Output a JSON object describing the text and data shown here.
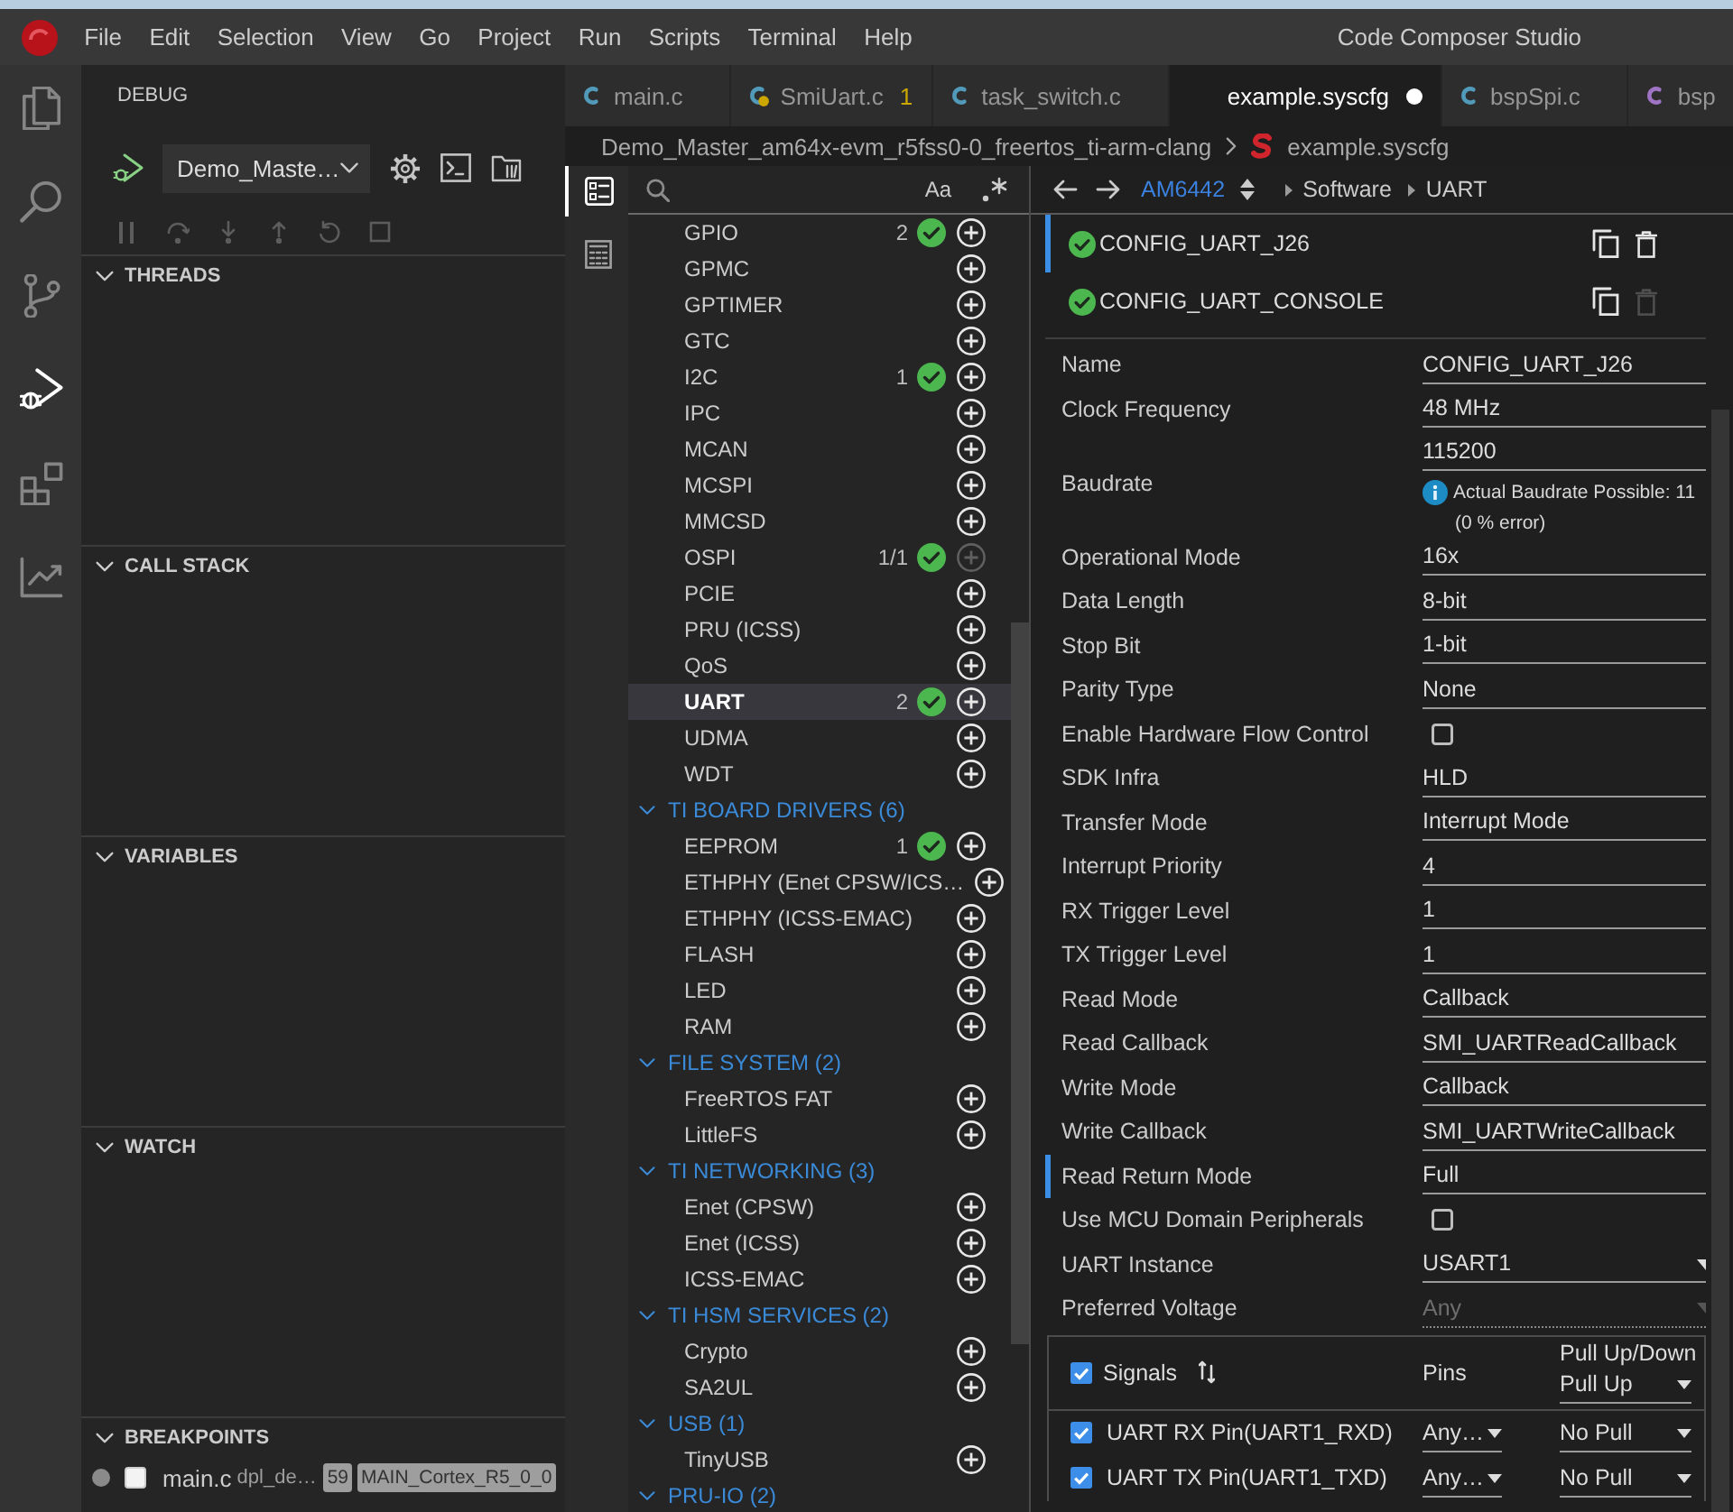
{
  "window": {
    "title": "Code Composer Studio"
  },
  "menu": [
    "File",
    "Edit",
    "Selection",
    "View",
    "Go",
    "Project",
    "Run",
    "Scripts",
    "Terminal",
    "Help"
  ],
  "activity_bar": [
    {
      "kind": "files",
      "selected": false
    },
    {
      "kind": "search",
      "selected": false
    },
    {
      "kind": "source_control",
      "selected": false
    },
    {
      "kind": "run_debug",
      "selected": true
    },
    {
      "kind": "extensions",
      "selected": false
    },
    {
      "kind": "chart",
      "selected": false
    }
  ],
  "sidebar": {
    "title": "DEBUG",
    "launch_config": "Demo_Maste…",
    "debug_controls": [
      {
        "kind": "pause",
        "disabled": true
      },
      {
        "kind": "step_over",
        "disabled": true
      },
      {
        "kind": "step_into",
        "disabled": true
      },
      {
        "kind": "step_out",
        "disabled": true
      },
      {
        "kind": "restart",
        "disabled": true
      },
      {
        "kind": "stop",
        "disabled": true
      }
    ],
    "sections": [
      {
        "title": "THREADS",
        "expanded": true
      },
      {
        "title": "CALL STACK",
        "expanded": true
      },
      {
        "title": "VARIABLES",
        "expanded": true
      },
      {
        "title": "WATCH",
        "expanded": true
      }
    ],
    "breakpoints": {
      "title": "BREAKPOINTS",
      "expanded": true,
      "items": [
        {
          "file": "main.c",
          "path": "dpl_de…",
          "line": "59",
          "core": "MAIN_Cortex_R5_0_0",
          "checked": false
        }
      ]
    }
  },
  "editor": {
    "tabs": [
      {
        "label": "main.c",
        "kind": "c",
        "color": "#519aba",
        "selected": false,
        "modified": false,
        "warning": false
      },
      {
        "label": "SmiUart.c",
        "kind": "c",
        "color": "#519aba",
        "selected": false,
        "modified": false,
        "warning": true,
        "problems": "1"
      },
      {
        "label": "task_switch.c",
        "kind": "c",
        "color": "#519aba",
        "selected": false,
        "modified": false,
        "warning": false
      },
      {
        "label": "example.syscfg",
        "kind": "plain",
        "selected": true,
        "modified": true,
        "warning": false
      },
      {
        "label": "bspSpi.c",
        "kind": "c",
        "color": "#519aba",
        "selected": false,
        "modified": false,
        "warning": false
      },
      {
        "label": "bsp",
        "kind": "c",
        "color": "#a074c4",
        "selected": false,
        "modified": false,
        "warning": false
      }
    ],
    "breadcrumb": [
      {
        "kind": "folder",
        "label": "Demo_Master_am64x-evm_r5fss0-0_freertos_ti-arm-clang"
      },
      {
        "kind": "syscfg",
        "label": "example.syscfg"
      }
    ]
  },
  "syscfg": {
    "side_tabs": [
      {
        "kind": "list",
        "selected": true
      },
      {
        "kind": "calculator",
        "selected": false
      }
    ],
    "search": {
      "match_case": "Aa"
    },
    "modules": [
      {
        "label": "GPIO",
        "count": "2",
        "configured": true,
        "selected": false,
        "add_disabled": false
      },
      {
        "label": "GPMC",
        "configured": false,
        "selected": false,
        "add_disabled": false
      },
      {
        "label": "GPTIMER",
        "configured": false,
        "selected": false,
        "add_disabled": false
      },
      {
        "label": "GTC",
        "configured": false,
        "selected": false,
        "add_disabled": false
      },
      {
        "label": "I2C",
        "count": "1",
        "configured": true,
        "selected": false,
        "add_disabled": false
      },
      {
        "label": "IPC",
        "configured": false,
        "selected": false,
        "add_disabled": false
      },
      {
        "label": "MCAN",
        "configured": false,
        "selected": false,
        "add_disabled": false
      },
      {
        "label": "MCSPI",
        "configured": false,
        "selected": false,
        "add_disabled": false
      },
      {
        "label": "MMCSD",
        "configured": false,
        "selected": false,
        "add_disabled": false
      },
      {
        "label": "OSPI",
        "count": "1/1",
        "configured": true,
        "selected": false,
        "add_disabled": true
      },
      {
        "label": "PCIE",
        "configured": false,
        "selected": false,
        "add_disabled": false
      },
      {
        "label": "PRU (ICSS)",
        "configured": false,
        "selected": false,
        "add_disabled": false
      },
      {
        "label": "QoS",
        "configured": false,
        "selected": false,
        "add_disabled": false
      },
      {
        "label": "UART",
        "count": "2",
        "configured": true,
        "selected": true,
        "add_disabled": false
      },
      {
        "label": "UDMA",
        "configured": false,
        "selected": false,
        "add_disabled": false
      },
      {
        "label": "WDT",
        "configured": false,
        "selected": false,
        "add_disabled": false
      }
    ],
    "categories": [
      {
        "label": "TI BOARD DRIVERS (6)",
        "expanded": true,
        "children": [
          {
            "label": "EEPROM",
            "count": "1",
            "configured": true,
            "selected": false,
            "add_disabled": false
          },
          {
            "label": "ETHPHY (Enet CPSW/ICS…",
            "configured": false,
            "selected": false,
            "add_disabled": false
          },
          {
            "label": "ETHPHY (ICSS-EMAC)",
            "configured": false,
            "selected": false,
            "add_disabled": false
          },
          {
            "label": "FLASH",
            "configured": false,
            "selected": false,
            "add_disabled": false
          },
          {
            "label": "LED",
            "configured": false,
            "selected": false,
            "add_disabled": false
          },
          {
            "label": "RAM",
            "configured": false,
            "selected": false,
            "add_disabled": false
          }
        ]
      },
      {
        "label": "FILE SYSTEM (2)",
        "expanded": true,
        "children": [
          {
            "label": "FreeRTOS FAT",
            "configured": false,
            "selected": false,
            "add_disabled": false
          },
          {
            "label": "LittleFS",
            "configured": false,
            "selected": false,
            "add_disabled": false
          }
        ]
      },
      {
        "label": "TI NETWORKING (3)",
        "expanded": true,
        "children": [
          {
            "label": "Enet (CPSW)",
            "configured": false,
            "selected": false,
            "add_disabled": false
          },
          {
            "label": "Enet (ICSS)",
            "configured": false,
            "selected": false,
            "add_disabled": false
          },
          {
            "label": "ICSS-EMAC",
            "configured": false,
            "selected": false,
            "add_disabled": false
          }
        ]
      },
      {
        "label": "TI HSM SERVICES (2)",
        "expanded": true,
        "children": [
          {
            "label": "Crypto",
            "configured": false,
            "selected": false,
            "add_disabled": false
          },
          {
            "label": "SA2UL",
            "configured": false,
            "selected": false,
            "add_disabled": false
          }
        ]
      },
      {
        "label": "USB (1)",
        "expanded": true,
        "children": [
          {
            "label": "TinyUSB",
            "configured": false,
            "selected": false,
            "add_disabled": false
          }
        ]
      },
      {
        "label": "PRU-IO (2)",
        "expanded": true
      }
    ],
    "config": {
      "device": "AM6442",
      "path": [
        "Software",
        "UART"
      ],
      "instances": [
        {
          "name": "CONFIG_UART_J26",
          "selected": true,
          "delete_disabled": false
        },
        {
          "name": "CONFIG_UART_CONSOLE",
          "selected": false,
          "delete_disabled": true
        }
      ],
      "fields": [
        {
          "kind": "text",
          "label": "Name",
          "value": "CONFIG_UART_J26",
          "focused": false,
          "disabled": false
        },
        {
          "kind": "text",
          "label": "Clock Frequency",
          "value": "48 MHz",
          "focused": false,
          "disabled": false
        },
        {
          "kind": "text",
          "label": "Baudrate",
          "value": "115200",
          "info": "Actual Baudrate Possible: 11",
          "info_detail": "(0 % error)",
          "focused": false,
          "disabled": false
        },
        {
          "kind": "text",
          "label": "Operational Mode",
          "value": "16x",
          "focused": false,
          "disabled": false
        },
        {
          "kind": "text",
          "label": "Data Length",
          "value": "8-bit",
          "focused": false,
          "disabled": false
        },
        {
          "kind": "text",
          "label": "Stop Bit",
          "value": "1-bit",
          "focused": false,
          "disabled": false
        },
        {
          "kind": "text",
          "label": "Parity Type",
          "value": "None",
          "focused": false,
          "disabled": false
        },
        {
          "kind": "checkbox",
          "label": "Enable Hardware Flow Control",
          "checked": false,
          "focused": false,
          "disabled": false
        },
        {
          "kind": "text",
          "label": "SDK Infra",
          "value": "HLD",
          "focused": false,
          "disabled": false
        },
        {
          "kind": "text",
          "label": "Transfer Mode",
          "value": "Interrupt Mode",
          "focused": false,
          "disabled": false
        },
        {
          "kind": "text",
          "label": "Interrupt Priority",
          "value": "4",
          "focused": false,
          "disabled": false
        },
        {
          "kind": "text",
          "label": "RX Trigger Level",
          "value": "1",
          "focused": false,
          "disabled": false
        },
        {
          "kind": "text",
          "label": "TX Trigger Level",
          "value": "1",
          "focused": false,
          "disabled": false
        },
        {
          "kind": "text",
          "label": "Read Mode",
          "value": "Callback",
          "focused": false,
          "disabled": false
        },
        {
          "kind": "text",
          "label": "Read Callback",
          "value": "SMI_UARTReadCallback",
          "focused": false,
          "disabled": false
        },
        {
          "kind": "text",
          "label": "Write Mode",
          "value": "Callback",
          "focused": false,
          "disabled": false
        },
        {
          "kind": "text",
          "label": "Write Callback",
          "value": "SMI_UARTWriteCallback",
          "focused": false,
          "disabled": false
        },
        {
          "kind": "text",
          "label": "Read Return Mode",
          "value": "Full",
          "focused": true,
          "disabled": false
        },
        {
          "kind": "checkbox",
          "label": "Use MCU Domain Peripherals",
          "checked": false,
          "focused": false,
          "disabled": false
        },
        {
          "kind": "select",
          "label": "UART Instance",
          "value": "USART1",
          "focused": false,
          "disabled": false
        },
        {
          "kind": "select",
          "label": "Preferred Voltage",
          "value": "Any",
          "focused": false,
          "disabled": true
        }
      ],
      "signals": {
        "checked": true,
        "label": "Signals",
        "pins_label": "Pins",
        "pull_label": "Pull Up/Down",
        "pull_value": "Pull Up",
        "rows": [
          {
            "checked": true,
            "name": "UART RX Pin(UART1_RXD)",
            "pin": "Any…",
            "pull": "No Pull"
          },
          {
            "checked": true,
            "name": "UART TX Pin(UART1_TXD)",
            "pin": "Any…",
            "pull": "No Pull"
          }
        ]
      }
    }
  }
}
